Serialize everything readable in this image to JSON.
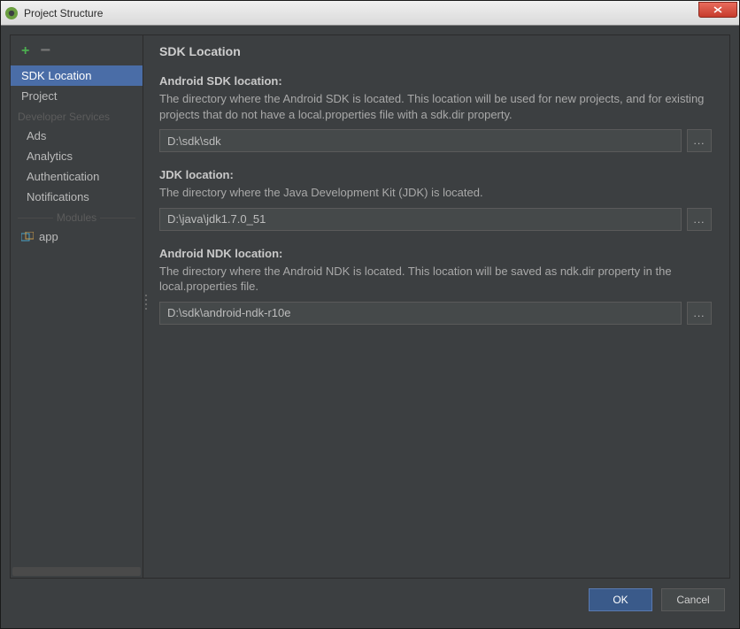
{
  "window": {
    "title": "Project Structure"
  },
  "sidebar": {
    "items": [
      {
        "label": "SDK Location",
        "selected": true
      },
      {
        "label": "Project",
        "selected": false
      }
    ],
    "developer_services_header": "Developer Services",
    "services": [
      {
        "label": "Ads"
      },
      {
        "label": "Analytics"
      },
      {
        "label": "Authentication"
      },
      {
        "label": "Notifications"
      }
    ],
    "modules_header": "Modules",
    "modules": [
      {
        "label": "app"
      }
    ]
  },
  "content": {
    "heading": "SDK Location",
    "sections": [
      {
        "title": "Android SDK location:",
        "desc": "The directory where the Android SDK is located. This location will be used for new projects, and for existing projects that do not have a local.properties file with a sdk.dir property.",
        "value": "D:\\sdk\\sdk"
      },
      {
        "title": "JDK location:",
        "desc": "The directory where the Java Development Kit (JDK) is located.",
        "value": "D:\\java\\jdk1.7.0_51"
      },
      {
        "title": "Android NDK location:",
        "desc": "The directory where the Android NDK is located. This location will be saved as ndk.dir property in the local.properties file.",
        "value": "D:\\sdk\\android-ndk-r10e"
      }
    ]
  },
  "footer": {
    "ok": "OK",
    "cancel": "Cancel"
  },
  "browse_label": "..."
}
